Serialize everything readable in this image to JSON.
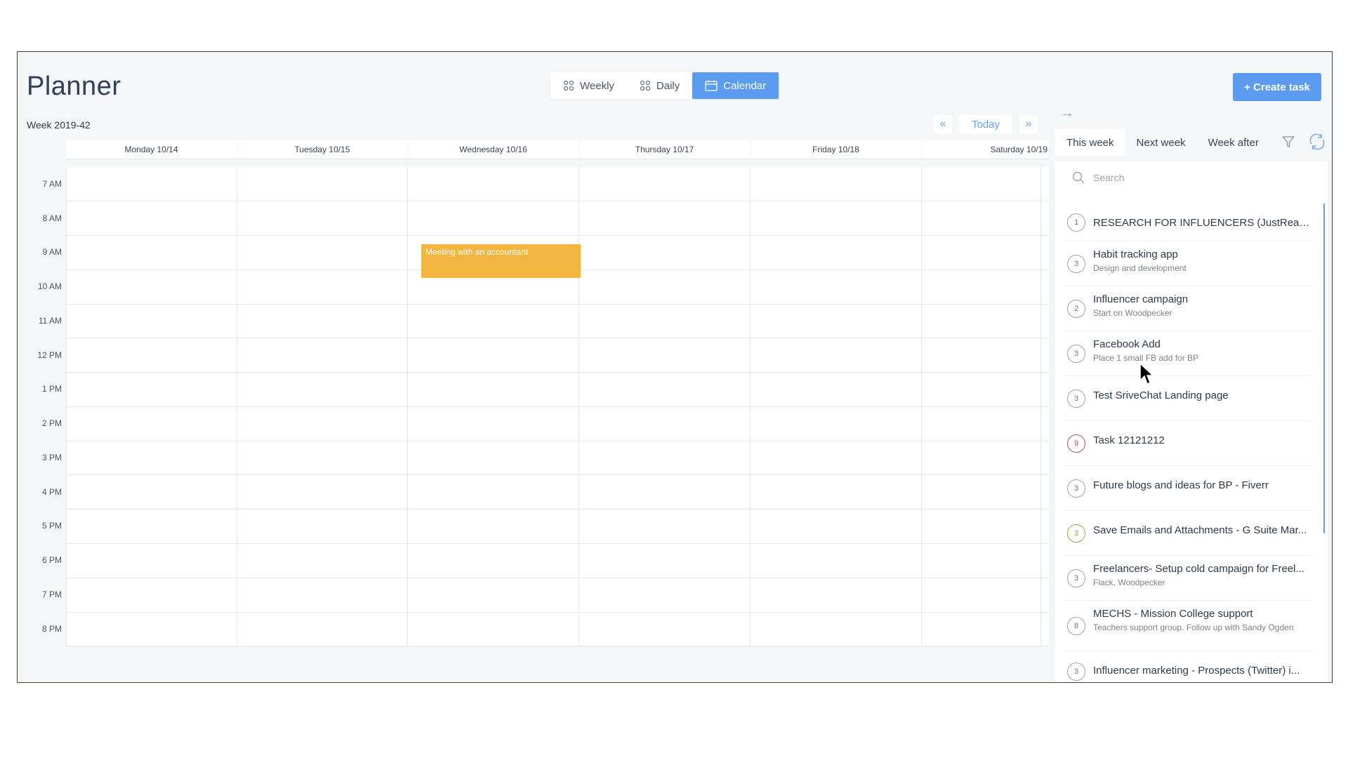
{
  "header": {
    "title": "Planner",
    "week_label": "Week 2019-42",
    "create_label": "+ Create task"
  },
  "views": [
    {
      "label": "Weekly",
      "icon": "grid-dots-icon",
      "active": false
    },
    {
      "label": "Daily",
      "icon": "grid-dots-icon",
      "active": false
    },
    {
      "label": "Calendar",
      "icon": "calendar-icon",
      "active": true
    }
  ],
  "nav": {
    "prev": "«",
    "today": "Today",
    "next": "»"
  },
  "calendar": {
    "days": [
      "Monday 10/14",
      "Tuesday 10/15",
      "Wednesday 10/16",
      "Thursday 10/17",
      "Friday 10/18",
      "Saturday 10/19"
    ],
    "hours": [
      "7 AM",
      "8 AM",
      "9 AM",
      "10 AM",
      "11 AM",
      "12 PM",
      "1 PM",
      "2 PM",
      "3 PM",
      "4 PM",
      "5 PM",
      "6 PM",
      "7 PM",
      "8 PM"
    ],
    "event": {
      "title": "Meeting with an accountant",
      "day": "Wednesday 10/16",
      "start": "9 AM",
      "end": "10 AM",
      "color": "#f1b540"
    }
  },
  "sidebar": {
    "collapse_arrow": "→",
    "tabs": [
      {
        "label": "This week",
        "active": true
      },
      {
        "label": "Next week",
        "active": false
      },
      {
        "label": "Week after",
        "active": false
      }
    ],
    "search_placeholder": "Search",
    "accent": "#5b9bf0",
    "tasks": [
      {
        "count": "1",
        "title": "RESEARCH FOR INFLUENCERS (JustReachOut...",
        "sub": "",
        "ring": "#9aa3ae"
      },
      {
        "count": "3",
        "title": "Habit tracking app",
        "sub": "Design and development",
        "ring": "#9aa3ae"
      },
      {
        "count": "2",
        "title": "Influencer campaign",
        "sub": "Start on Woodpecker",
        "ring": "#9aa3ae"
      },
      {
        "count": "3",
        "title": "Facebook Add",
        "sub": "Place 1 small FB add for BP",
        "ring": "#9aa3ae"
      },
      {
        "count": "3",
        "title": "Test SriveChat Landing page",
        "sub": "",
        "ring": "#9aa3ae"
      },
      {
        "count": "9",
        "title": "Task 12121212",
        "sub": "",
        "ring": "#c0504d"
      },
      {
        "count": "3",
        "title": "Future blogs and ideas for BP - Fiverr",
        "sub": "",
        "ring": "#9aa3ae"
      },
      {
        "count": "3",
        "title": "Save Emails and Attachments - G Suite Mar...",
        "sub": "",
        "ring": "#7fb24a"
      },
      {
        "count": "3",
        "title": "Freelancers- Setup cold campaign for Freel...",
        "sub": "Flack, Woodpecker",
        "ring": "#9aa3ae"
      },
      {
        "count": "8",
        "title": "MECHS - Mission College support",
        "sub": "Teachers support group. Follow up with Sandy Ogden",
        "ring": "#9aa3ae"
      },
      {
        "count": "3",
        "title": "Influencer marketing - Prospects (Twitter) i...",
        "sub": "",
        "ring": "#9aa3ae"
      }
    ]
  }
}
